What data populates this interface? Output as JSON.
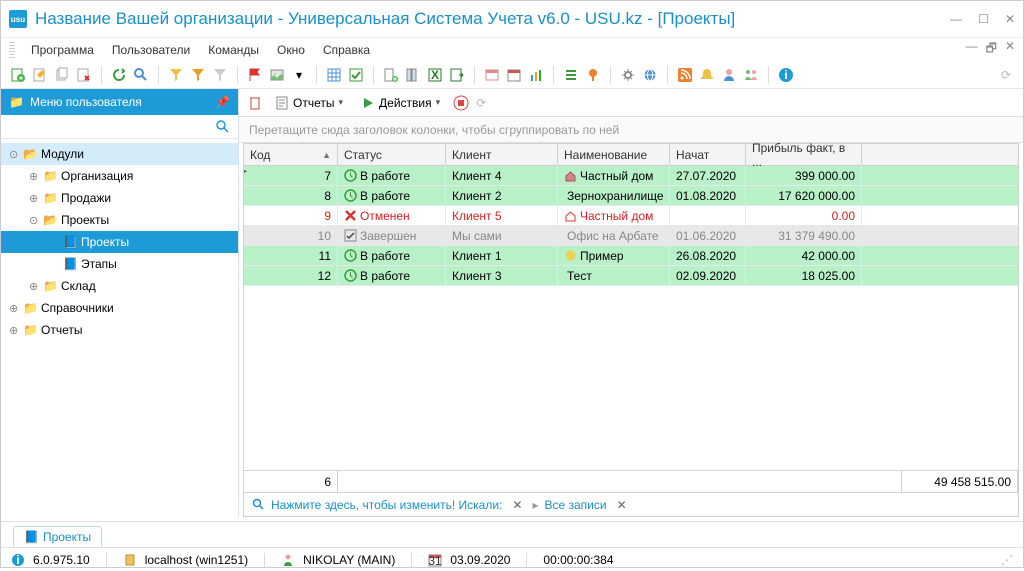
{
  "window": {
    "title": "Название Вашей организации - Универсальная Система Учета v6.0 - USU.kz - [Проекты]"
  },
  "menu": {
    "items": [
      "Программа",
      "Пользователи",
      "Команды",
      "Окно",
      "Справка"
    ]
  },
  "sidebar": {
    "title": "Меню пользователя",
    "tree": {
      "modules": "Модули",
      "organization": "Организация",
      "sales": "Продажи",
      "projects": "Проекты",
      "projects_sub": "Проекты",
      "stages": "Этапы",
      "warehouse": "Склад",
      "references": "Справочники",
      "reports": "Отчеты"
    }
  },
  "content": {
    "reports_btn": "Отчеты",
    "actions_btn": "Действия",
    "group_hint": "Перетащите сюда заголовок колонки, чтобы сгруппировать по ней",
    "columns": {
      "code": "Код",
      "status": "Статус",
      "client": "Клиент",
      "name": "Наименование",
      "started": "Начат",
      "profit": "Прибыль факт, в ..."
    },
    "rows": [
      {
        "code": "7",
        "status": "В работе",
        "client": "Клиент 4",
        "name": "Частный дом",
        "started": "27.07.2020",
        "profit": "399 000.00",
        "style": "green",
        "status_style": "work",
        "name_icon": "house"
      },
      {
        "code": "8",
        "status": "В работе",
        "client": "Клиент 2",
        "name": "Зернохранилище",
        "started": "01.08.2020",
        "profit": "17 620 000.00",
        "style": "green",
        "status_style": "work",
        "name_icon": "grain"
      },
      {
        "code": "9",
        "status": "Отменен",
        "client": "Клиент 5",
        "name": "Частный дом",
        "started": "",
        "profit": "0.00",
        "style": "white-red",
        "status_style": "cancel",
        "name_icon": "house-red"
      },
      {
        "code": "10",
        "status": "Завершен",
        "client": "Мы сами",
        "name": "Офис на Арбате",
        "started": "01.06.2020",
        "profit": "31 379 490.00",
        "style": "gray",
        "status_style": "done",
        "name_icon": ""
      },
      {
        "code": "11",
        "status": "В работе",
        "client": "Клиент 1",
        "name": "Пример",
        "started": "26.08.2020",
        "profit": "42 000.00",
        "style": "green",
        "status_style": "work",
        "name_icon": "yellow"
      },
      {
        "code": "12",
        "status": "В работе",
        "client": "Клиент 3",
        "name": "Тест",
        "started": "02.09.2020",
        "profit": "18 025.00",
        "style": "green",
        "status_style": "work",
        "name_icon": ""
      }
    ],
    "footer": {
      "count": "6",
      "total": "49 458 515.00"
    },
    "filter": {
      "text": "Нажмите здесь, чтобы изменить! Искали:",
      "all": "Все записи"
    }
  },
  "tabs": {
    "active": "Проекты"
  },
  "status": {
    "version": "6.0.975.10",
    "host": "localhost (win1251)",
    "user": "NIKOLAY (MAIN)",
    "date": "03.09.2020",
    "time": "00:00:00:384"
  }
}
